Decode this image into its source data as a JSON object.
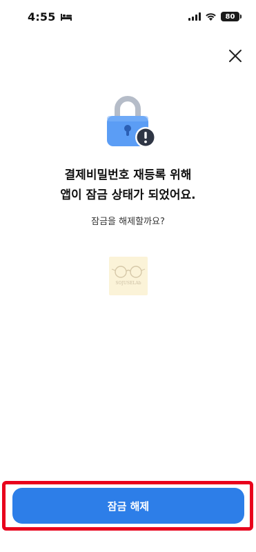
{
  "status_bar": {
    "time": "4:55",
    "battery": "80",
    "icons": [
      "bed-icon",
      "cellular-signal-icon",
      "wifi-icon",
      "battery-icon"
    ]
  },
  "header": {
    "close_icon": "close-icon"
  },
  "illustration": {
    "icon": "lock-alert-icon",
    "lock_color": "#5b9df5",
    "badge_color": "#2f3645"
  },
  "message": {
    "line1": "결제비밀번호 재등록 위해",
    "line2": "앱이 잠금 상태가 되었어요.",
    "question": "잠금을 해제할까요?"
  },
  "watermark": {
    "text": "SOJUSELAb"
  },
  "cta": {
    "label": "잠금 해제",
    "color": "#2d7ee8",
    "highlight_color": "#e8001c"
  }
}
